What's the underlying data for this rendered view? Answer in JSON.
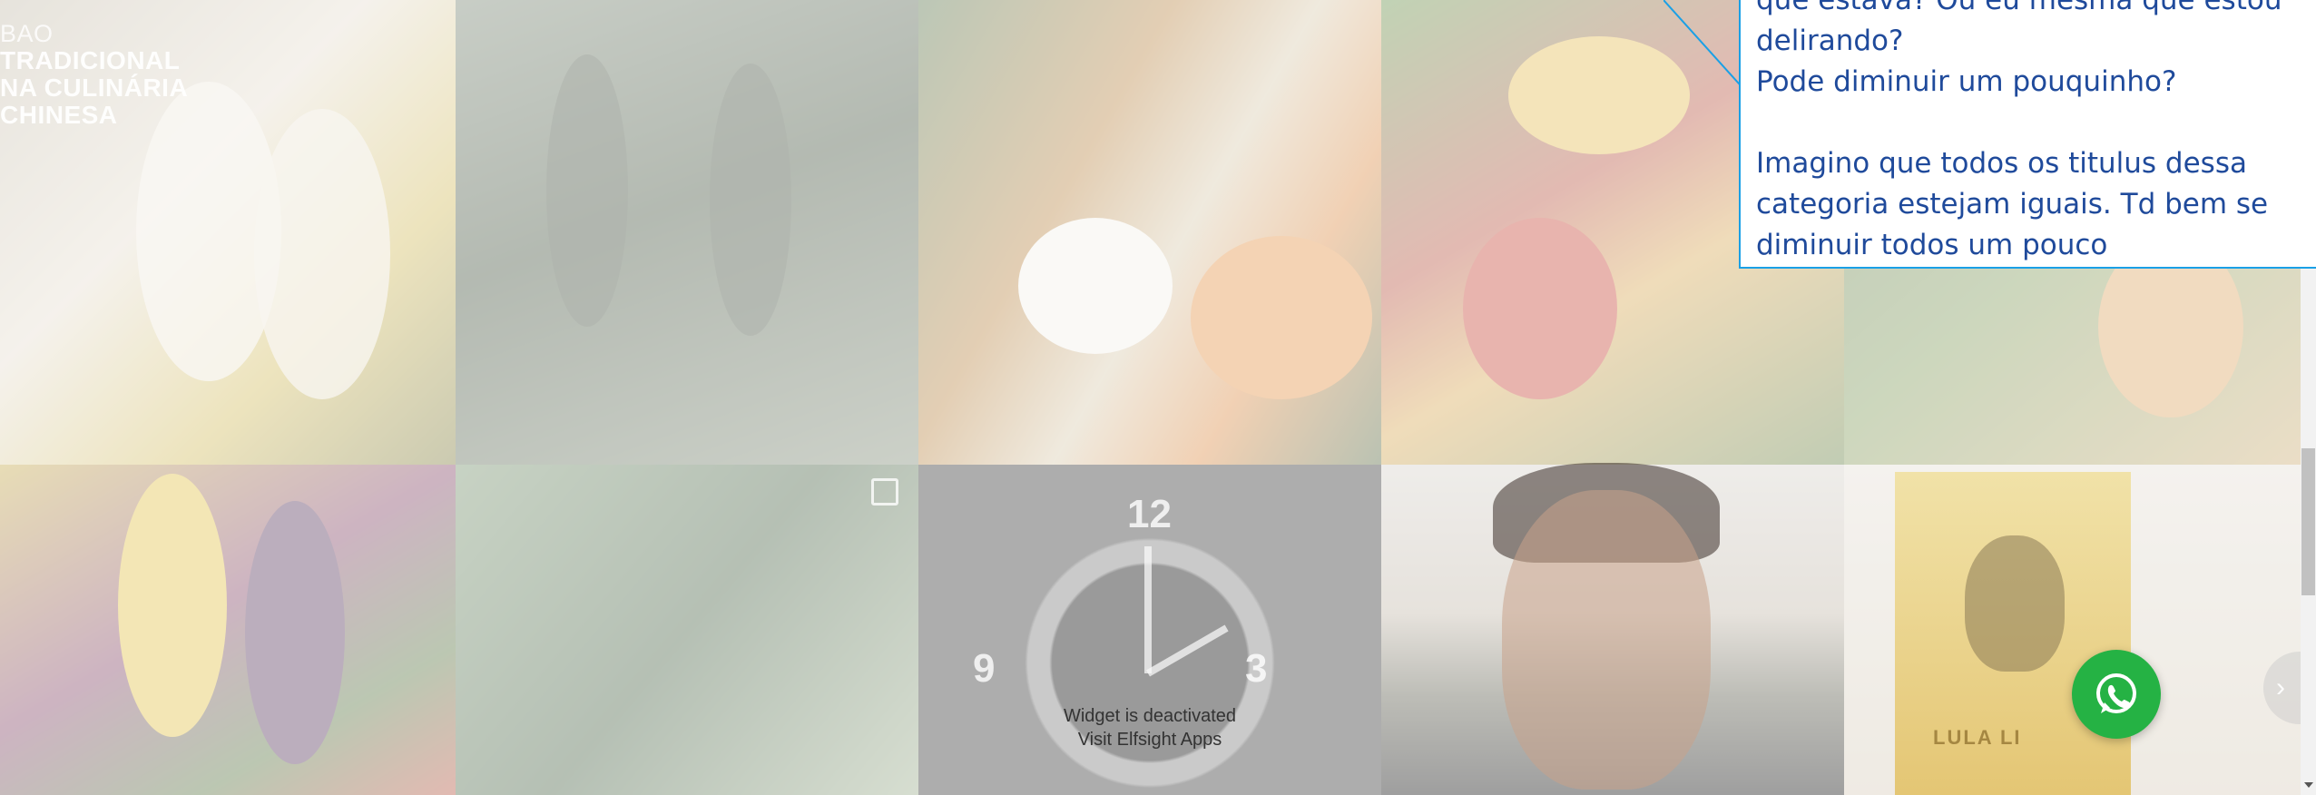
{
  "grid": {
    "banner_tile": {
      "pre": "BAO",
      "lines": [
        "TRADICIONAL",
        "NA CULINÁRIA",
        "CHINESA"
      ]
    },
    "poster_text": "LULA LI"
  },
  "widget": {
    "line1": "Widget is deactivated",
    "line2": "Visit Elfsight Apps"
  },
  "comment": {
    "partial_line": "que estava? Ou eu mesma que estou",
    "line2": "delirando?",
    "line3": "Pode diminuir um pouquinho?",
    "para2_line1": "Imagino que todos os titulus dessa",
    "para2_line2": "categoria estejam iguais. Td bem se",
    "para2_line3": "diminuir todos um pouco"
  },
  "carousel": {
    "next_glyph": "›"
  },
  "colors": {
    "comment_border": "#1aa0e6",
    "comment_text": "#1f4a9b",
    "whatsapp_green": "#25b244",
    "scroll_thumb": "#c1c1c1"
  },
  "icons": {
    "whatsapp": "whatsapp-icon",
    "collection": "collection-icon",
    "next": "chevron-right-icon",
    "scroll_down": "arrow-down-icon"
  }
}
